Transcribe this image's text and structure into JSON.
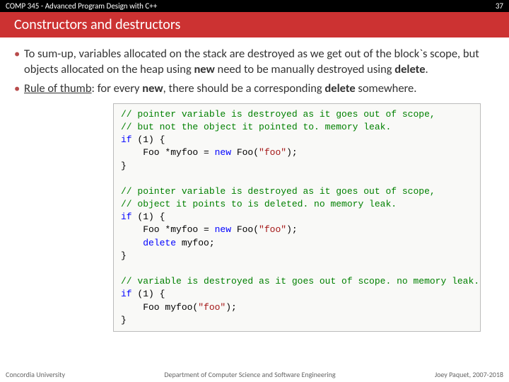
{
  "header": {
    "course": "COMP 345 - Advanced Program Design with C++",
    "page_number": "37"
  },
  "title": "Constructors and destructors",
  "bullet1": {
    "t1": "To sum-up, variables allocated on the stack are destroyed as we get out of the block`s scope, but objects allocated on the heap using ",
    "b1": "new",
    "t2": " need to be manually destroyed using ",
    "b2": "delete",
    "t3": "."
  },
  "bullet2": {
    "u1": "Rule of thumb",
    "t1": ": for every ",
    "b1": "new",
    "t2": ", there should be a corresponding ",
    "b2": "delete",
    "t3": " somewhere."
  },
  "code": {
    "c1a": "// pointer variable is destroyed as it goes out of scope,",
    "c1b": "// but not the object it pointed to. memory leak.",
    "k_if": "if",
    "paren1": " (1) {",
    "line1a": "    Foo *myfoo = ",
    "k_new": "new",
    "line1b": " Foo(",
    "str_foo": "\"foo\"",
    "line1c": ");",
    "brace": "}",
    "blank": "",
    "c2a": "// pointer variable is destroyed as it goes out of scope,",
    "c2b": "// object it points to is deleted. no memory leak.",
    "line2del_a": "    ",
    "k_delete": "delete",
    "line2del_b": " myfoo;",
    "c3a": "// variable is destroyed as it goes out of scope. no memory leak.",
    "line3a": "    Foo myfoo(",
    "line3b": ");"
  },
  "footer": {
    "left": "Concordia University",
    "center": "Department of Computer Science and Software Engineering",
    "right": "Joey Paquet, 2007-2018"
  }
}
